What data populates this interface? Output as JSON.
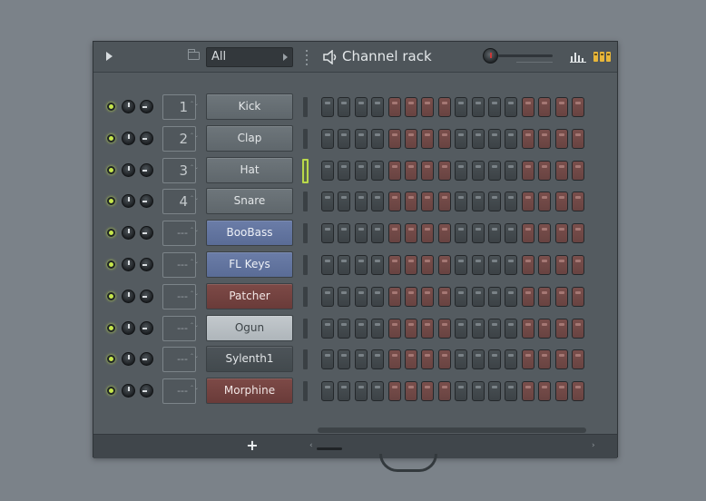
{
  "header": {
    "filter_value": "All",
    "title": "Channel rack",
    "icons": [
      "play-arrow-icon",
      "folder-icon",
      "grip-icon",
      "speaker-icon",
      "swing-knob-icon",
      "graph-editor-icon",
      "step-sequencer-icon"
    ]
  },
  "channels": [
    {
      "name": "Kick",
      "track": "1",
      "color": "gray"
    },
    {
      "name": "Clap",
      "track": "2",
      "color": "gray"
    },
    {
      "name": "Hat",
      "track": "3",
      "color": "gray",
      "selected": true
    },
    {
      "name": "Snare",
      "track": "4",
      "color": "gray"
    },
    {
      "name": "BooBass",
      "track": "---",
      "color": "blue"
    },
    {
      "name": "FL Keys",
      "track": "---",
      "color": "blue"
    },
    {
      "name": "Patcher",
      "track": "---",
      "color": "red"
    },
    {
      "name": "Ogun",
      "track": "---",
      "color": "light"
    },
    {
      "name": "Sylenth1",
      "track": "---",
      "color": "dark"
    },
    {
      "name": "Morphine",
      "track": "---",
      "color": "red"
    }
  ],
  "steps_per_row": 16,
  "step_group_pattern": [
    "g",
    "g",
    "g",
    "g",
    "r",
    "r",
    "r",
    "r",
    "g",
    "g",
    "g",
    "g",
    "r",
    "r",
    "r",
    "r"
  ],
  "footer": {
    "add_label": "+",
    "scroll_left": "‹",
    "scroll_right": "›"
  },
  "colors": {
    "background": "#7b8289",
    "window": "#545b60",
    "led": "#c6e64b",
    "step_dark": "#444b4f",
    "step_red": "#724a47",
    "channel_blue": "#6275a0",
    "channel_red": "#744340"
  }
}
